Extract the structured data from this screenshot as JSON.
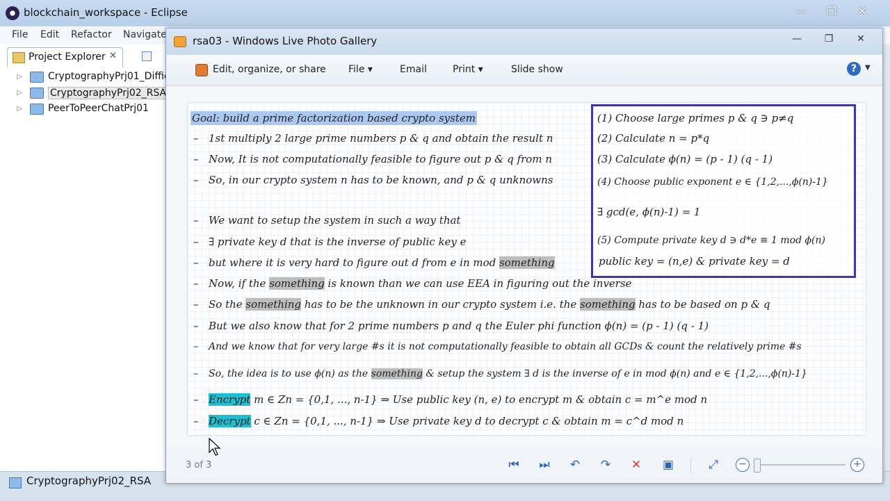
{
  "eclipse": {
    "title": "blockchain_workspace - Eclipse",
    "window_controls": [
      "—",
      "❐",
      "✕"
    ],
    "menu": [
      "File",
      "Edit",
      "Refactor",
      "Navigate"
    ],
    "project_explorer": {
      "tab_label": "Project Explorer",
      "close": "✕",
      "items": [
        {
          "label": "CryptographyPrj01_Diffie"
        },
        {
          "label": "CryptographyPrj02_RSA"
        },
        {
          "label": "PeerToPeerChatPrj01"
        }
      ]
    },
    "status": "CryptographyPrj02_RSA"
  },
  "gallery": {
    "title": "rsa03 - Windows Live Photo Gallery",
    "window_controls": [
      "—",
      "❐",
      "✕"
    ],
    "toolbar": {
      "edit": "Edit, organize, or share",
      "file": "File ▾",
      "email": "Email",
      "print": "Print ▾",
      "slideshow": "Slide show",
      "help": "?"
    },
    "counter": "3 of 3",
    "controls": {
      "first": "⏮",
      "next": "⏭",
      "rotate_left": "↶",
      "rotate_right": "↷",
      "delete": "✕",
      "slideshow": "▣",
      "fit": "⤢",
      "zoom_minus": "−",
      "zoom_plus": "+"
    }
  },
  "slide": {
    "goal": "Goal: build a prime factorization based crypto system",
    "lines": [
      {
        "t1": "1st multiply 2 large prime numbers p & q and obtain the result n"
      },
      {
        "t1": "Now, It is not computationally feasible to figure out p & q from n"
      },
      {
        "t1": "So, in our crypto system n has to be known, and p & q unknowns"
      },
      {
        "t1": "We want to setup the system in such a way that"
      },
      {
        "t1": "∃ private key d that is the inverse of public key e"
      },
      {
        "t1": "but where it is very hard to figure out d from e in mod ",
        "h1": "something"
      },
      {
        "t1": "Now, if the ",
        "h1": "something",
        "t2": " is known than we can use EEA in figuring out the inverse"
      },
      {
        "t1": "So the ",
        "h1": "something",
        "t2": " has to be the unknown in our crypto system i.e. the ",
        "h2": "something",
        "t3": " has to be based on p & q"
      },
      {
        "t1": "But we also know that for 2 prime numbers p and q the Euler phi function ϕ(n) = (p - 1) (q - 1)"
      },
      {
        "t1": "And we know that for very large #s it is not computationally feasible to obtain all GCDs & count the relatively prime #s"
      },
      {
        "t1": "So, the idea is to use ϕ(n) as the ",
        "h1": "something",
        "t2": " & setup the system ∃ d is the inverse of e in mod ϕ(n) and e ∈ {1,2,...,ϕ(n)-1}"
      },
      {
        "c1": "Encrypt",
        "t1": " m ∈ Zn = {0,1, ..., n-1} ⇒ Use public key (n, e) to encrypt m & obtain c = m^e mod n"
      },
      {
        "c1": "Decrypt",
        "t1": " c ∈ Zn = {0,1, ..., n-1} ⇒ Use private key d to decrypt c & obtain m = c^d mod n"
      }
    ],
    "dash": "–",
    "steps": [
      "(1)  Choose large primes p & q ∋ p≠q",
      "(2)  Calculate n = p*q",
      "(3)  Calculate ϕ(n) = (p - 1) (q - 1)",
      "(4)  Choose public exponent e ∈ {1,2,...,ϕ(n)-1}",
      "        ∃ gcd(e, ϕ(n)-1) = 1",
      "(5)  Compute private key d ∋ d*e ≡ 1 mod ϕ(n)",
      "public key = (n,e)        &       private key = d"
    ]
  }
}
